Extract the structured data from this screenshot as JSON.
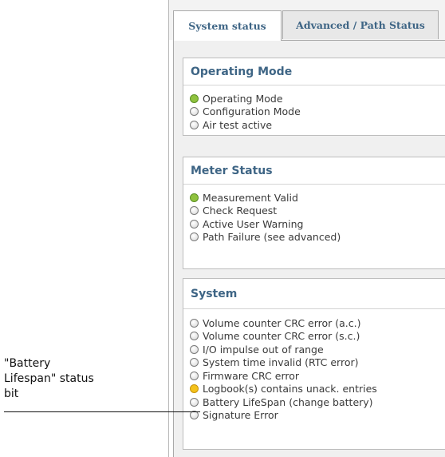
{
  "tabs": [
    {
      "label": "System status",
      "active": true
    },
    {
      "label": "Advanced / Path Status",
      "active": false
    }
  ],
  "groups": {
    "operating_mode": {
      "title": "Operating Mode",
      "items": [
        {
          "label": "Operating Mode",
          "state": "green"
        },
        {
          "label": "Configuration Mode",
          "state": "off"
        },
        {
          "label": "Air test active",
          "state": "off"
        }
      ]
    },
    "meter_status": {
      "title": "Meter Status",
      "items": [
        {
          "label": "Measurement Valid",
          "state": "green"
        },
        {
          "label": "Check Request",
          "state": "off"
        },
        {
          "label": "Active User Warning",
          "state": "off"
        },
        {
          "label": "Path Failure (see advanced)",
          "state": "off"
        }
      ]
    },
    "system": {
      "title": "System",
      "items": [
        {
          "label": "Volume counter CRC error (a.c.)",
          "state": "off"
        },
        {
          "label": "Volume counter CRC error (s.c.)",
          "state": "off"
        },
        {
          "label": "I/O impulse out of range",
          "state": "off"
        },
        {
          "label": "System time invalid (RTC error)",
          "state": "off"
        },
        {
          "label": "Firmware CRC error",
          "state": "off"
        },
        {
          "label": "Logbook(s) contains unack. entries",
          "state": "yellow"
        },
        {
          "label": "Battery LifeSpan (change battery)",
          "state": "off"
        },
        {
          "label": "Signature Error",
          "state": "off"
        }
      ]
    }
  },
  "annotation": {
    "line1": "\"Battery",
    "line2": "Lifespan\" status",
    "line3": "bit"
  },
  "colors": {
    "header_text": "#3e6585",
    "led_green": "#8fc23e",
    "led_yellow": "#f4c21b",
    "led_off": "#e2e2e2"
  }
}
